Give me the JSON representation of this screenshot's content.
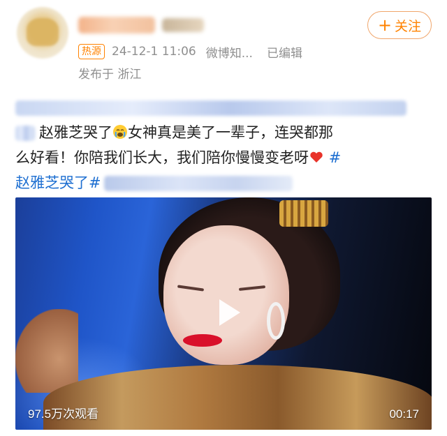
{
  "author": {
    "username": "",
    "follow_label": "关注"
  },
  "meta": {
    "badge": "热源",
    "timestamp": "24-12-1 11:06",
    "source": "微博知...",
    "edited": "已编辑",
    "location": "发布于 浙江"
  },
  "post": {
    "line2_tail": "赵雅芝哭了",
    "line2_rest": "女神真是美了一辈子，连哭都那",
    "line3": "么好看！你陪我们长大，我们陪你慢慢变老呀",
    "hashtag_mark": "#",
    "line4_hashtag": "赵雅芝哭了#"
  },
  "video": {
    "views": "97.5万次观看",
    "duration": "00:17"
  },
  "icons": {
    "emoji_cry": "crying-face-icon",
    "emoji_heart": "red-heart-icon",
    "play": "play-icon",
    "plus": "plus-icon"
  },
  "colors": {
    "accent": "#ff8200",
    "link": "#1e6fd1",
    "meta": "#8f8f8f"
  }
}
